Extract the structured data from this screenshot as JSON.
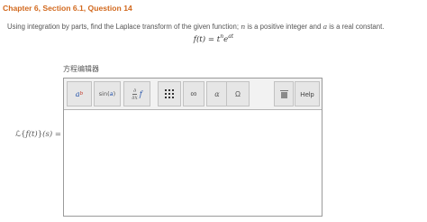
{
  "chapter_title": "Chapter 6, Section 6.1, Question 14",
  "question": {
    "text_1": "Using integration by parts, find the Laplace transform of the given function; ",
    "var_n": "n",
    "text_2": " is a positive integer and ",
    "var_a": "a",
    "text_3": " is a real constant."
  },
  "formula": {
    "lhs": "f(t) = ",
    "base_t": "t",
    "exp_n": "n",
    "base_e": "e",
    "exp_at": "at"
  },
  "editor": {
    "label": "方程编辑器",
    "toolbar": {
      "superscript": {
        "base": "a",
        "sup": "b"
      },
      "trig": {
        "fn": "sin(",
        "arg": "a",
        "close": ")"
      },
      "derivative": {
        "num": "∂",
        "den": "∂x",
        "f": "f"
      },
      "infinity": "∞",
      "alpha": "α",
      "omega": "Ω",
      "help": "Help"
    }
  },
  "answer_label": {
    "L": "ℒ",
    "open": "{",
    "func": "f(t)",
    "close": "}",
    "arg": "(s) ="
  }
}
